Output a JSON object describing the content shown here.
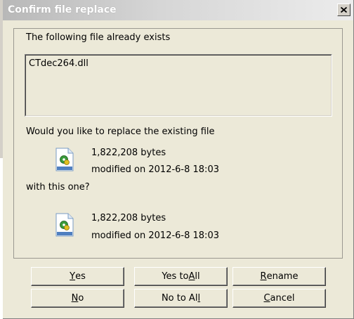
{
  "window": {
    "title": "Confirm file replace"
  },
  "message": {
    "exists_label": "The following file already exists",
    "filename": "CTdec264.dll",
    "replace_question": "Would you like to replace the existing file",
    "with_label": "with this one?"
  },
  "existing_file": {
    "size": "1,822,208 bytes",
    "modified": "modified on 2012-6-8 18:03"
  },
  "new_file": {
    "size": "1,822,208 bytes",
    "modified": "modified on 2012-6-8 18:03"
  },
  "buttons": {
    "yes": {
      "pre": "",
      "key": "Y",
      "post": "es"
    },
    "yes_to_all": {
      "pre": "Yes to ",
      "key": "A",
      "post": "ll"
    },
    "rename": {
      "pre": "",
      "key": "R",
      "post": "ename"
    },
    "no": {
      "pre": "",
      "key": "N",
      "post": "o"
    },
    "no_to_all": {
      "pre": "No to Al",
      "key": "l",
      "post": ""
    },
    "cancel": {
      "pre": "",
      "key": "C",
      "post": "ancel"
    }
  },
  "icons": {
    "close": "close-icon",
    "file": "dll-file-icon"
  },
  "colors": {
    "titlebar_start": "#b8b8b8",
    "titlebar_end": "#ececec",
    "dialog_bg": "#ece9d8"
  }
}
